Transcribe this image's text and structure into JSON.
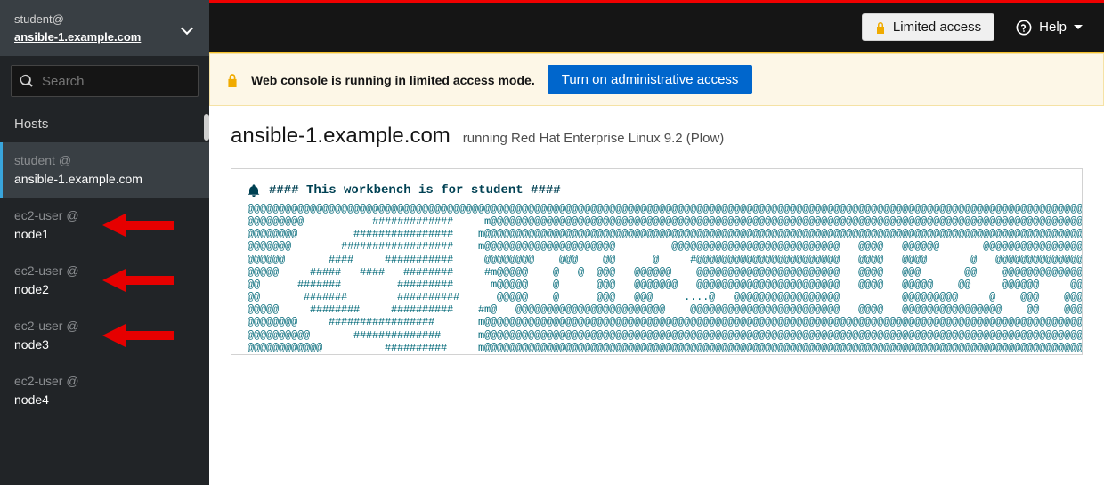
{
  "sidebar": {
    "user": "student@",
    "host": "ansible-1.example.com",
    "search_placeholder": "Search",
    "hosts_label": "Hosts",
    "items": [
      {
        "user": "student @",
        "host": "ansible-1.example.com",
        "active": true
      },
      {
        "user": "ec2-user @",
        "host": "node1",
        "arrow": true
      },
      {
        "user": "ec2-user @",
        "host": "node2",
        "arrow": true
      },
      {
        "user": "ec2-user @",
        "host": "node3",
        "arrow": true
      },
      {
        "user": "ec2-user @",
        "host": "node4"
      }
    ]
  },
  "topbar": {
    "limited_label": "Limited access",
    "help_label": "Help"
  },
  "alert": {
    "text": "Web console is running in limited access mode.",
    "button": "Turn on administrative access"
  },
  "header": {
    "title": "ansible-1.example.com",
    "subtitle": "running Red Hat Enterprise Linux 9.2 (Plow)"
  },
  "motd": {
    "headline": "#### This workbench is for student ####",
    "art": "@@@@@@@@@@@@@@@@@@@@@@@@@@@@@@@@@@@@@@@@@@@@@@@@@@@@@@@@@@@@@@@@@@@@@@@@@@@@@@@@@@@@@@@@@@@@@@@@@@@@@@@@@@@@@@@@@@@@@@@@@@@@@@@@@@@@@@@@\n@@@@@@@@@           #############     m@@@@@@@@@@@@@@@@@@@@@@@@@@@@@@@@@@@@@@@@@@@@@@@@@@@@@@@@@@@@@@@@@@@@@@@@@@@@@@@@@@@@@@@@@@@@@@@@@\n@@@@@@@@         ################    m@@@@@@@@@@@@@@@@@@@@@@@@@@@@@@@@@@@@@@@@@@@@@@@@@@@@@@@@@@@@@@@@@@@@@@@@@@@@@@@@@@@@@@@@@@@@@@@@@@\n@@@@@@@        ##################    m@@@@@@@@@@@@@@@@@@@@@         @@@@@@@@@@@@@@@@@@@@@@@@@@@   @@@@   @@@@@@       @@@@@@@@@@@@@@@@@@\n@@@@@@       ####     ###########     @@@@@@@@    @@@    @@      @     #@@@@@@@@@@@@@@@@@@@@@@@   @@@@   @@@@       @   @@@@@@@@@@@@@@@@\n@@@@@     #####   ####   ########     #m@@@@@    @   @  @@@   @@@@@@    @@@@@@@@@@@@@@@@@@@@@@@   @@@@   @@@       @@    @@@@@@@@@@@@@@@\n@@      #######         #########      m@@@@@    @      @@@   @@@@@@@   @@@@@@@@@@@@@@@@@@@@@@@   @@@@   @@@@@    @@     @@@@@@     @@@@\n@@       #######        ##########      @@@@@    @      @@@   @@@     ....@   @@@@@@@@@@@@@@@@@          @@@@@@@@@     @    @@@    @@@@@\n@@@@@     ########     ##########    #m@   @@@@@@@@@@@@@@@@@@@@@@@@    @@@@@@@@@@@@@@@@@@@@@@@@   @@@@   @@@@@@@@@@@@@@@@    @@    @@@@@\n@@@@@@@@     #################       m@@@@@@@@@@@@@@@@@@@@@@@@@@@@@@@@@@@@@@@@@@@@@@@@@@@@@@@@@@@@@@@@@@@@@@@@@@@@@@@@@@@@@@@@@@@@@@@@@@\n@@@@@@@@@@       ##############      m@@@@@@@@@@@@@@@@@@@@@@@@@@@@@@@@@@@@@@@@@@@@@@@@@@@@@@@@@@@@@@@@@@@@@@@@@@@@@@@@@@@@@@@@@@@@@@@@@@\n@@@@@@@@@@@@          ##########     m@@@@@@@@@@@@@@@@@@@@@@@@@@@@@@@@@@@@@@@@@@@@@@@@@@@@@@@@@@@@@@@@@@@@@@@@@@@@@@@@@@@@@@@@@@@@@@@@@@"
  }
}
